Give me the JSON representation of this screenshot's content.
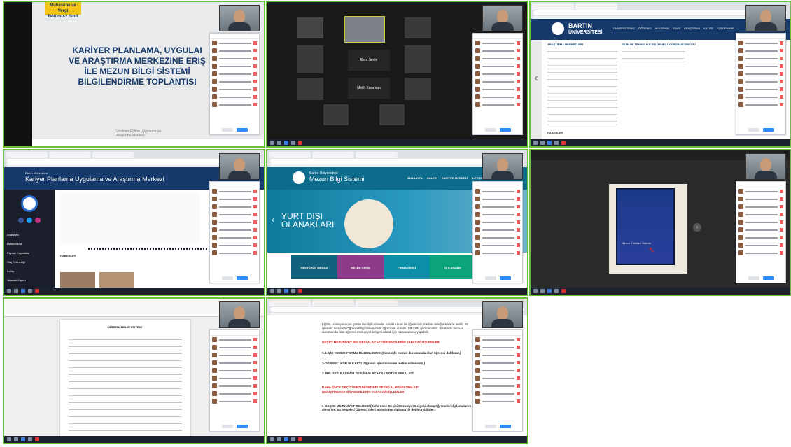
{
  "slide": {
    "badge_line1": "Muhasebe ve Vergi",
    "badge_line2": "Bölümü-2.Sınıf",
    "title_lines": [
      "KARİYER PLANLAMA, UYGULAI",
      "VE ARAŞTIRMA MERKEZİNE ERİŞ",
      "İLE MEZUN BİLGİ SİSTEMİ",
      "BİLGİLENDİRME TOPLANTISI"
    ],
    "footer_line1": "Uzaktan Eğitim Uygulama ve",
    "footer_line2": "Araştırma Merkezi"
  },
  "gallery": {
    "names": [
      "Esra Sevis",
      "Melih Karaman"
    ]
  },
  "bartin": {
    "logo_line1": "BARTIN",
    "logo_line2": "ÜNİVERSİTESİ",
    "nav": [
      "ÜNİVERSİTEMİZ",
      "ÖĞRENCİ",
      "AKADEMİK",
      "İDARİ",
      "ARAŞTIRMA",
      "KALİTE",
      "KÜTÜPHANE"
    ],
    "side_title": "ARAŞTIRMA MERKEZLERİ",
    "col2_title": "BİLİM VE TEKNOLOJİ DIŞ GENEL KOORDİNATÖRLÜĞÜ",
    "footer": "HABERLER"
  },
  "kariyer": {
    "org_small": "Bartın Üniversitesi",
    "org": "Kariyer Planlama Uygulama ve Araştırma Merkezi",
    "menu": [
      "Anasayfa",
      "Hakkımızda",
      "Faydalı Kaynaklar",
      "Staj Rehberliği",
      "Kulüp",
      "Yetenek Kapısı",
      "Kariyer Danışmanlığı"
    ],
    "section": "HABERLER"
  },
  "mezun": {
    "org_small": "Bartın Üniversitesi",
    "org": "Mezun Bilgi Sistemi",
    "nav": [
      "ANASAYFA",
      "GALERİ",
      "KARİYER MERKEZİ",
      "İLETİŞİM"
    ],
    "hero_line1": "YURT DIŞI",
    "hero_line2": "OLANAKLARI",
    "tiles": [
      "REKTÖRÜN MESAJI",
      "MEZUN GİRİŞİ",
      "FİRMA GİRİŞİ",
      "İŞ İLANLARI"
    ]
  },
  "phone": {
    "title": "Mezun Yönetim Sistemi"
  },
  "doc": {
    "heading": "ÖĞRENCİ BİLGİ SİSTEMİ"
  },
  "info": {
    "intro": "Eğitim komisyonunun görüşü ve ilgili yönetim kurulu kararı ile öğrencinin mezun olduğuna karar verilir. Bu işlemler sonunda Öğrenci Bilgi Sistemi'nde öğrencilik durumu MEZUN görünecektir. Sistemde mezun durumunda olan öğrenci mezuniyet belgesi almak için başvurusunu yapabilir.",
    "red1": "GEÇİCİ MEZUNİYET BELGESİ ALACAK ÖĞRENCİLERİN YAPACAĞI İŞLEMLER",
    "item1": "1.İLİŞİK KESME FORMU DÜZENLEMEK (Sistemde mezun durumunda olan öğrenci doldurur.)",
    "item2": "2-ÖĞRENCİ KİMLİK KARTI (Öğrenci işleri birimine teslim edilecektir.)",
    "item3": "3. BELGEYİ BAŞKASI TESLİM ALACAKSA NOTER VEKALETİ",
    "red2": "DAHA ÖNCE GEÇİCİ MEZUNİYET BELGESİNİ ALIP DİPLOMA İLE",
    "red3": "DEĞİŞTİRECEK ÖĞRENCİLERİN YAPACAĞI İŞLEMLER",
    "item4": "1-GEÇİCİ MEZUNİYET BELGESİ (Daha önce Geçici Mezuniyet Belgesi almış öğrenciler diplomalarını almış ise, bu belgeleri Öğrenci İşleri Biriminden diploma ile değiştirebilirler.)"
  },
  "colors": {
    "border": "#6bbf3a",
    "navy": "#163a6b",
    "red": "#d42020",
    "teal": "#0d6c8c"
  }
}
